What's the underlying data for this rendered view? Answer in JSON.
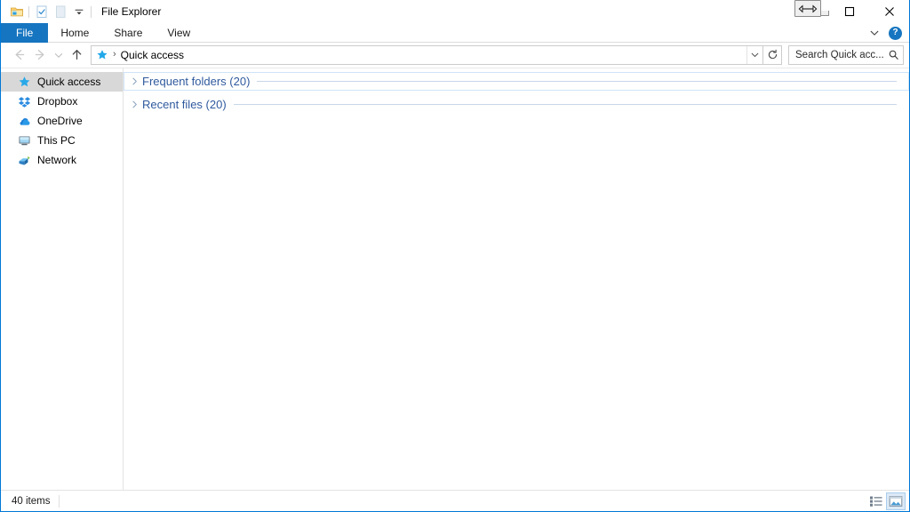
{
  "window": {
    "title": "File Explorer",
    "accent_color": "#0078d7",
    "file_tab_color": "#1675c0"
  },
  "quick_access_toolbar": {
    "items": [
      {
        "name": "properties-folder-icon",
        "label": "Properties"
      },
      {
        "name": "new-folder-checkbox-icon",
        "label": "New folder"
      },
      {
        "name": "blank-page-icon",
        "label": "Customize"
      },
      {
        "name": "customize-qat-dropdown-icon",
        "label": "Customize Quick Access Toolbar"
      }
    ]
  },
  "window_controls": {
    "minimize": "Minimize",
    "maximize": "Maximize",
    "close": "Close",
    "cursor_overlay": "horizontal-resize-cursor"
  },
  "ribbon": {
    "tabs": [
      {
        "label": "File",
        "selected": true
      },
      {
        "label": "Home",
        "selected": false
      },
      {
        "label": "Share",
        "selected": false
      },
      {
        "label": "View",
        "selected": false
      }
    ],
    "expand_label": "Expand the Ribbon",
    "help_label": "?"
  },
  "navigation": {
    "back_label": "Back",
    "forward_label": "Forward",
    "recent_label": "Recent locations",
    "up_label": "Up one level",
    "refresh_label": "Refresh",
    "address_dropdown_label": "Previous locations"
  },
  "address": {
    "icon": "quick-access-star-icon",
    "separator": "›",
    "path_text": "Quick access"
  },
  "search": {
    "placeholder": "Search Quick acc...",
    "icon": "search-icon"
  },
  "sidebar": {
    "items": [
      {
        "label": "Quick access",
        "icon": "star-icon",
        "selected": true
      },
      {
        "label": "Dropbox",
        "icon": "dropbox-icon",
        "selected": false
      },
      {
        "label": "OneDrive",
        "icon": "onedrive-cloud-icon",
        "selected": false
      },
      {
        "label": "This PC",
        "icon": "computer-icon",
        "selected": false
      },
      {
        "label": "Network",
        "icon": "network-icon",
        "selected": false
      }
    ]
  },
  "content": {
    "groups": [
      {
        "title": "Frequent folders (20)",
        "expanded": false,
        "focused": true
      },
      {
        "title": "Recent files (20)",
        "expanded": false,
        "focused": false
      }
    ]
  },
  "status": {
    "item_count_text": "40 items",
    "views": [
      {
        "name": "details-view-button",
        "label": "Details view",
        "active": false
      },
      {
        "name": "large-icons-view-button",
        "label": "Large icons view",
        "active": true
      }
    ]
  }
}
